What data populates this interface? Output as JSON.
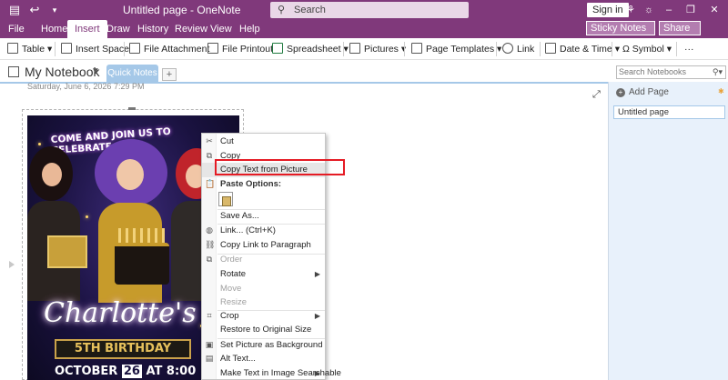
{
  "window": {
    "title": "Untitled page - OneNote",
    "search_placeholder": "Search",
    "signin_label": "Sign in"
  },
  "menu_tabs": [
    "File",
    "Home",
    "Insert",
    "Draw",
    "History",
    "Review",
    "View",
    "Help"
  ],
  "active_tab": "Insert",
  "header_buttons": {
    "sticky_notes": "Sticky Notes",
    "share": "Share"
  },
  "ribbon": {
    "table": "Table",
    "insert_space": "Insert Space",
    "file_attachment": "File Attachment",
    "file_printout": "File Printout",
    "spreadsheet": "Spreadsheet",
    "pictures": "Pictures",
    "page_templates": "Page Templates",
    "link": "Link",
    "date_time": "Date & Time",
    "symbol": "Symbol",
    "more": "···"
  },
  "notebook": {
    "name": "My Notebook",
    "section_tab": "Quick Notes",
    "add_tab": "+",
    "search_placeholder": "Search Notebooks"
  },
  "page": {
    "date": "Saturday, June 6, 2026",
    "time": "7:29 PM"
  },
  "page_list": {
    "add_page": "Add Page",
    "pages": [
      "Untitled page"
    ]
  },
  "picture": {
    "headline": "COME AND JOIN US TO CELEBRATE",
    "name": "Charlotte's",
    "subtitle": "5TH BIRTHDAY",
    "date_prefix": "OCTOBER",
    "date_day": "26",
    "date_suffix": "AT 8:00"
  },
  "context_menu": {
    "cut": "Cut",
    "copy": "Copy",
    "copy_text_from_picture": "Copy Text from Picture",
    "paste_options": "Paste Options:",
    "save_as": "Save As...",
    "link": "Link...  (Ctrl+K)",
    "copy_link_to_paragraph": "Copy Link to Paragraph",
    "order": "Order",
    "rotate": "Rotate",
    "move": "Move",
    "resize": "Resize",
    "crop": "Crop",
    "restore": "Restore to Original Size",
    "set_background": "Set Picture as Background",
    "alt_text": "Alt Text...",
    "make_searchable": "Make Text in Image Searchable"
  },
  "colors": {
    "accent": "#80397b",
    "section_tab": "#a5c8e8",
    "page_pane": "#e8f1fb",
    "highlight_box": "#e51b24"
  }
}
